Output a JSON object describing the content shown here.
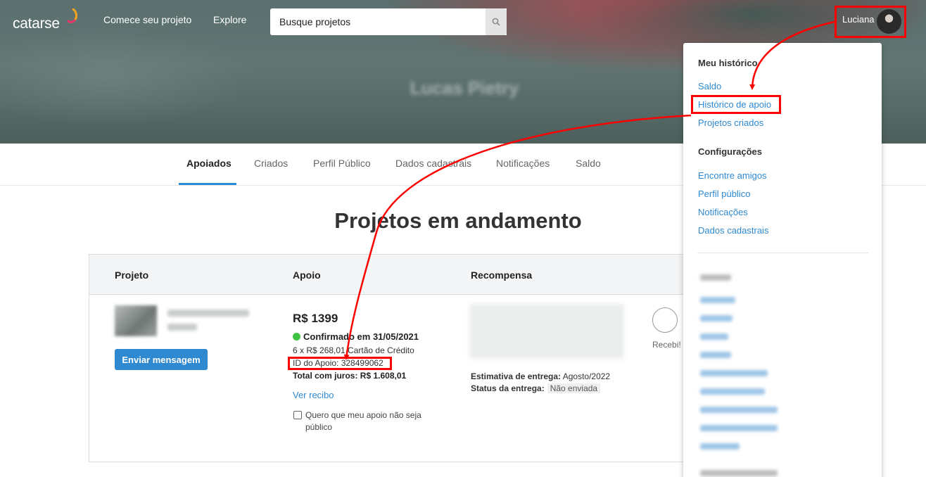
{
  "header": {
    "logo": "catarse",
    "nav": [
      "Comece seu projeto",
      "Explore"
    ],
    "search_placeholder": "Busque projetos",
    "user_name": "Luciana"
  },
  "tabs": [
    "Apoiados",
    "Criados",
    "Perfil Público",
    "Dados cadastrais",
    "Notificações",
    "Saldo"
  ],
  "page_title": "Projetos em andamento",
  "table": {
    "headers": [
      "Projeto",
      "Apoio",
      "Recompensa"
    ],
    "row": {
      "send_message": "Enviar mensagem",
      "amount": "R$ 1399",
      "status": "Confirmado em 31/05/2021",
      "installments": "6 x R$ 268,01 Cartão de Crédito",
      "support_id": "ID do Apoio: 328499062",
      "total": "Total com juros: R$ 1.608,01",
      "receipt_link": "Ver recibo",
      "private_checkbox": "Quero que meu apoio não seja público",
      "delivery_estimate_label": "Estimativa de entrega:",
      "delivery_estimate_value": "Agosto/2022",
      "delivery_status_label": "Status da entrega:",
      "delivery_status_value": "Não enviada",
      "received_label": "Recebi!"
    }
  },
  "dropdown": {
    "history_heading": "Meu histórico",
    "history_links": [
      "Saldo",
      "Histórico de apoio",
      "Projetos criados"
    ],
    "settings_heading": "Configurações",
    "settings_links": [
      "Encontre amigos",
      "Perfil público",
      "Notificações",
      "Dados cadastrais"
    ]
  },
  "colors": {
    "accent": "#2f89d0",
    "annotation": "#ff0000",
    "success": "#3fc441"
  }
}
